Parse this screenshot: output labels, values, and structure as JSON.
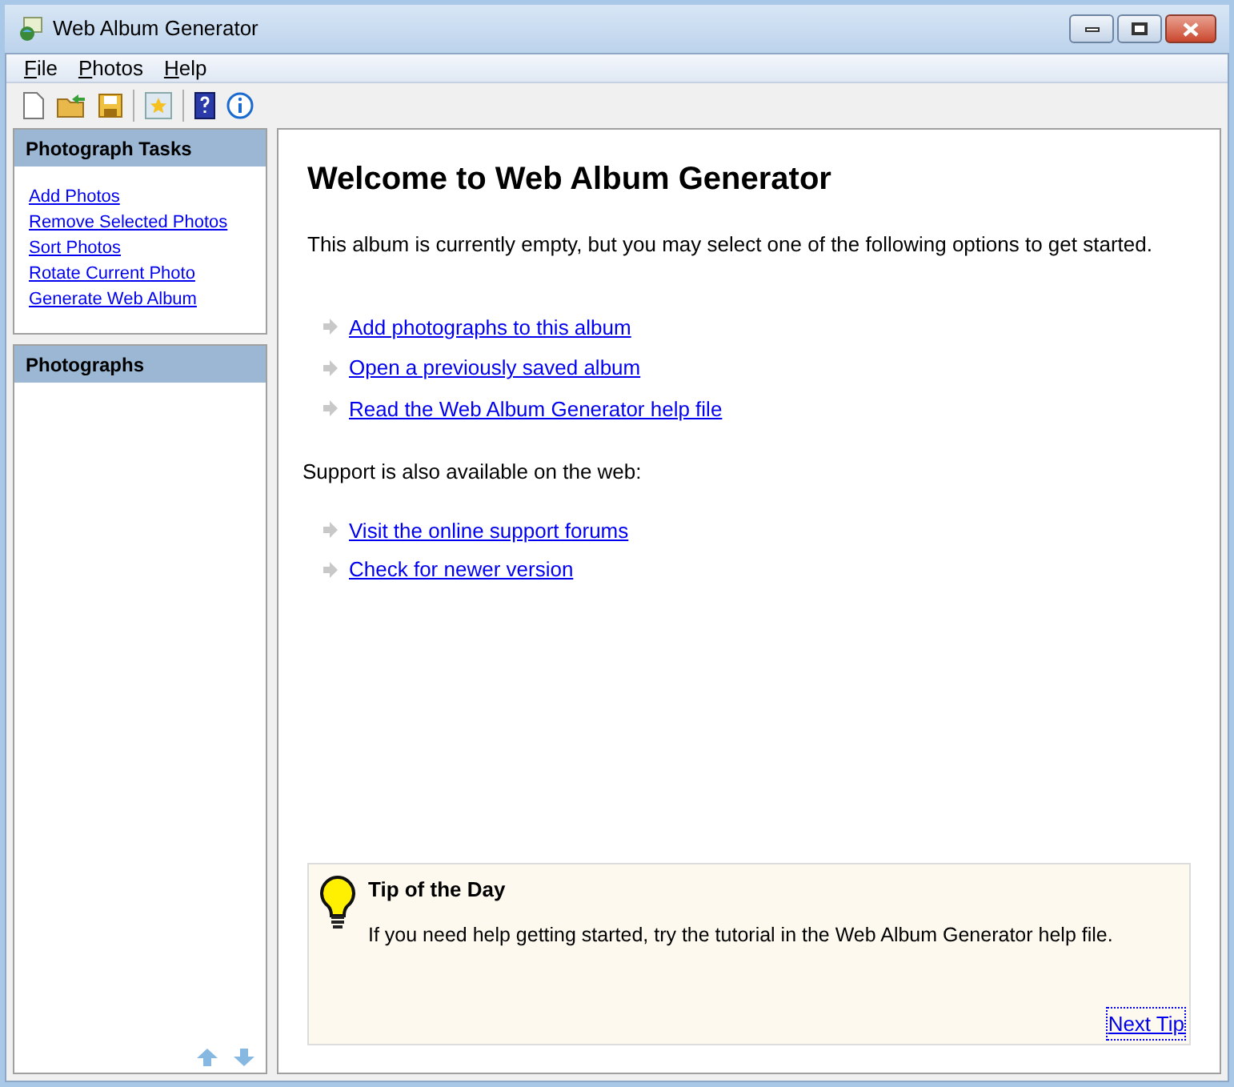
{
  "window": {
    "title": "Web Album Generator"
  },
  "menu": [
    {
      "label": "File"
    },
    {
      "label": "Photos"
    },
    {
      "label": "Help"
    }
  ],
  "sidebar": {
    "tasks": {
      "title": "Photograph Tasks",
      "links": [
        "Add Photos",
        "Remove Selected Photos",
        "Sort Photos",
        "Rotate Current Photo",
        "Generate Web Album"
      ]
    },
    "photographs": {
      "title": "Photographs"
    }
  },
  "main": {
    "heading": "Welcome to Web Album Generator",
    "intro": "This album is currently empty, but you may select one of the following options to get started.",
    "options": [
      "Add photographs to this album",
      "Open a previously saved album",
      "Read the Web Album Generator help file"
    ],
    "support_text": "Support is also available on the web:",
    "support_links": [
      "Visit the online support forums",
      "Check for newer version"
    ],
    "tip": {
      "title": "Tip of the Day",
      "text": "If you need help getting started, try the tutorial in the Web Album Generator help file.",
      "next": "Next Tip"
    }
  }
}
